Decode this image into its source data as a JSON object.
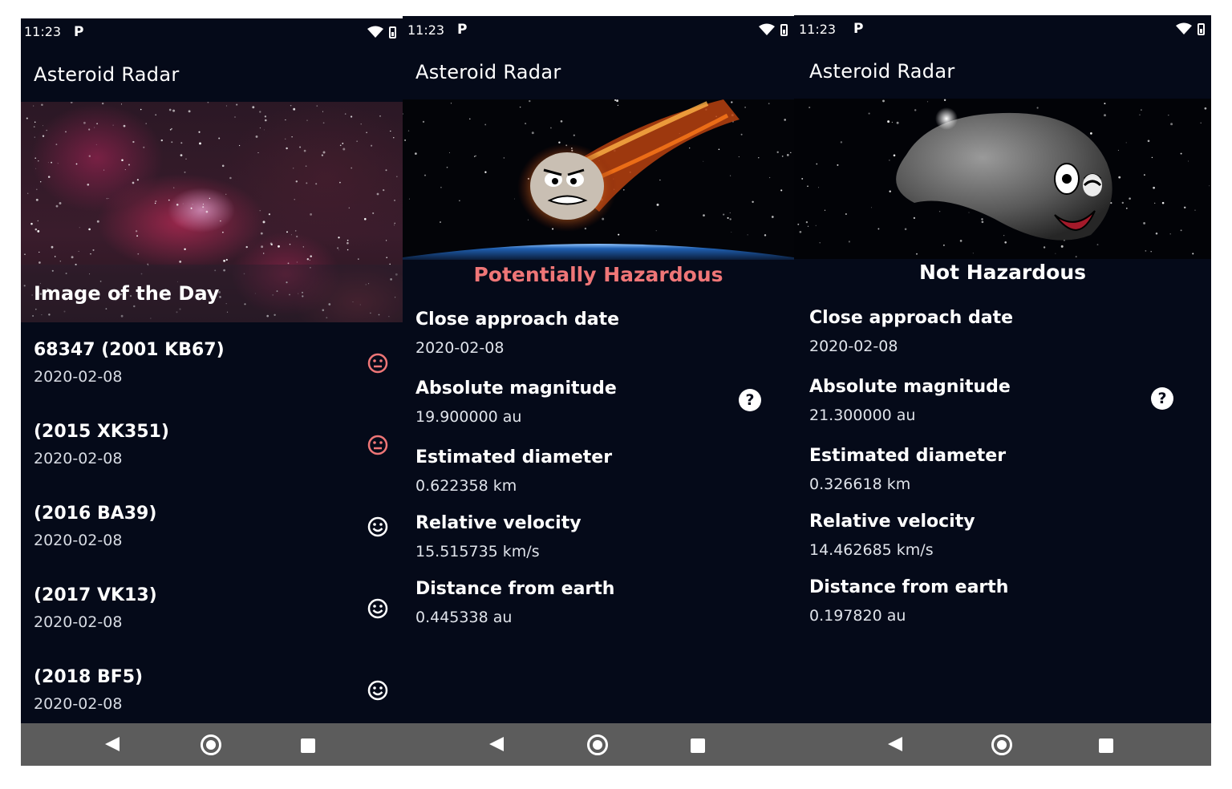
{
  "status": {
    "time": "11:23",
    "notification_glyph": "P"
  },
  "app": {
    "title": "Asteroid Radar"
  },
  "main_screen": {
    "image_caption": "Image of the Day",
    "asteroids": [
      {
        "code": "68347 (2001 KB67)",
        "date": "2020-02-08",
        "hazardous": true
      },
      {
        "code": "(2015 XK351)",
        "date": "2020-02-08",
        "hazardous": true
      },
      {
        "code": "(2016 BA39)",
        "date": "2020-02-08",
        "hazardous": false
      },
      {
        "code": "(2017 VK13)",
        "date": "2020-02-08",
        "hazardous": false
      },
      {
        "code": "(2018 BF5)",
        "date": "2020-02-08",
        "hazardous": false
      }
    ]
  },
  "labels": {
    "close_approach": "Close approach date",
    "abs_magnitude": "Absolute magnitude",
    "diameter": "Estimated diameter",
    "velocity": "Relative velocity",
    "distance": "Distance from earth",
    "help_glyph": "?"
  },
  "detail_hazardous": {
    "status_text": "Potentially Hazardous",
    "close_approach_date": "2020-02-08",
    "absolute_magnitude": "19.900000 au",
    "estimated_diameter": "0.622358 km",
    "relative_velocity": "15.515735 km/s",
    "distance_from_earth": "0.445338 au"
  },
  "detail_safe": {
    "status_text": "Not Hazardous",
    "close_approach_date": "2020-02-08",
    "absolute_magnitude": "21.300000 au",
    "estimated_diameter": "0.326618 km",
    "relative_velocity": "14.462685 km/s",
    "distance_from_earth": "0.197820 au"
  },
  "colors": {
    "background": "#050a19",
    "hazardous_accent": "#ef7677",
    "safe_accent": "#ffffff",
    "nav_bar": "#5c5c5c"
  },
  "icons": {
    "hazardous_status": "sad-face-icon",
    "safe_status": "happy-face-icon",
    "help": "help-circle-icon",
    "wifi": "wifi-icon",
    "battery": "battery-icon",
    "back": "nav-back-icon",
    "home": "nav-home-icon",
    "recents": "nav-recents-icon"
  }
}
